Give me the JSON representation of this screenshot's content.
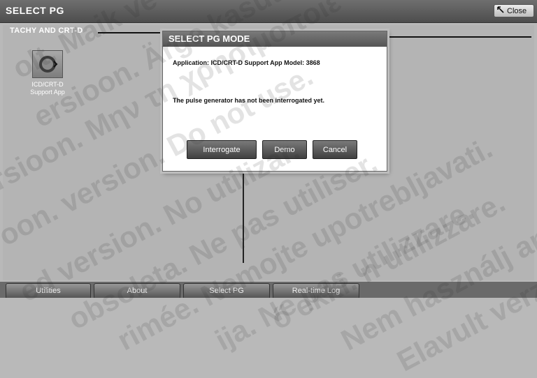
{
  "window": {
    "title": "SELECT PG",
    "close_label": "Close"
  },
  "group": {
    "label": "TACHY AND CRT-D"
  },
  "app_tile": {
    "label_line1": "ICD/CRT-D",
    "label_line2": "Support App"
  },
  "dialog": {
    "title": "SELECT PG MODE",
    "application_text": "Application: ICD/CRT-D Support App Model: 3868",
    "status_text": "The pulse generator has not been interrogated yet.",
    "buttons": {
      "interrogate": "Interrogate",
      "demo": "Demo",
      "cancel": "Cancel"
    }
  },
  "bottom_nav": {
    "utilities": "Utilities",
    "about": "About",
    "select_pg": "Select PG",
    "realtime_log": "Real-time Log"
  },
  "watermark_lines": [
    "olt. Maik ve",
    "ersioon. Ärge kasutu",
    "rsioon. Μην τη χρησιμοποιε",
    "oon. version. Do not use.",
    "ed version. No utilizar.",
    "obsoleta. Ne pas utiliser.",
    "rimée. Nemojte upotrebljavati.",
    "ija. Ne pas utilizzare.",
    "ő ekki. n utilizzare.",
    "Nem használj antot. ite.",
    "Elavult verzió. Ne használja."
  ]
}
